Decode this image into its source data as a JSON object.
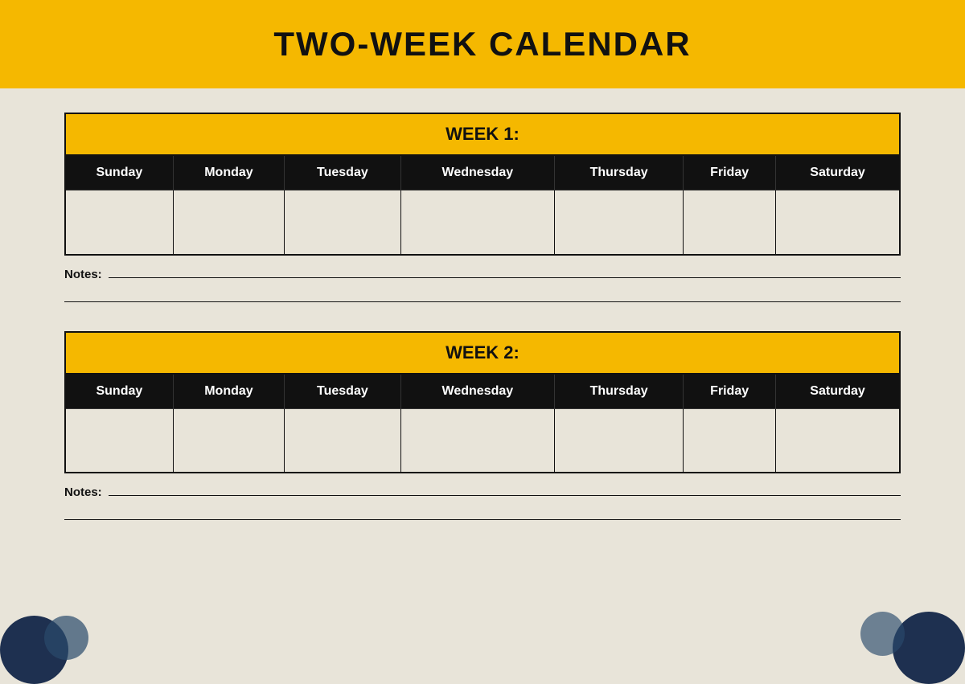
{
  "header": {
    "title": "TWO-WEEK CALENDAR"
  },
  "week1": {
    "label": "WEEK 1:",
    "days": [
      "Sunday",
      "Monday",
      "Tuesday",
      "Wednesday",
      "Thursday",
      "Friday",
      "Saturday"
    ],
    "notes_label": "Notes:"
  },
  "week2": {
    "label": "WEEK 2:",
    "days": [
      "Sunday",
      "Monday",
      "Tuesday",
      "Wednesday",
      "Thursday",
      "Friday",
      "Saturday"
    ],
    "notes_label": "Notes:"
  },
  "colors": {
    "yellow": "#f5b800",
    "black": "#111111",
    "bg": "#e8e4d9",
    "dark_blue": "#1e3050"
  }
}
